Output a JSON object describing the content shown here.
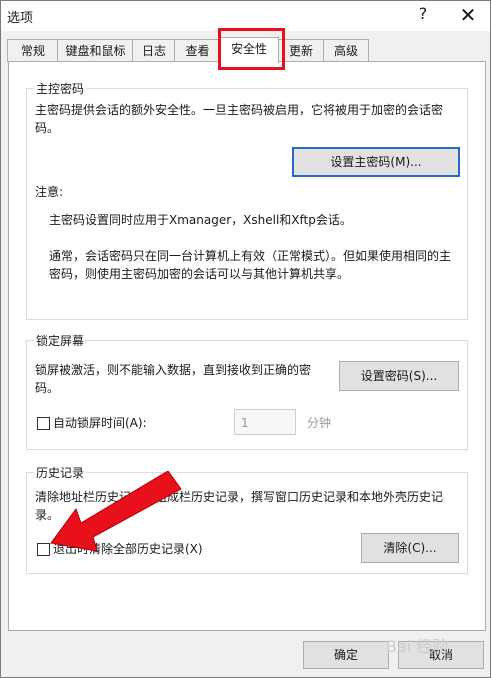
{
  "window": {
    "title": "选项",
    "help_glyph": "?",
    "close_glyph": "✕"
  },
  "tabs": [
    {
      "label": "常规"
    },
    {
      "label": "键盘和鼠标"
    },
    {
      "label": "日志"
    },
    {
      "label": "查看"
    },
    {
      "label": "安全性",
      "active": true
    },
    {
      "label": "更新"
    },
    {
      "label": "高级"
    }
  ],
  "master_password": {
    "legend": "主控密码",
    "description": "主密码提供会话的额外安全性。一旦主密码被启用，它将被用于加密的会话密码。",
    "set_button": "设置主密码(M)...",
    "note_title": "注意:",
    "note_1": "主密码设置同时应用于Xmanager，Xshell和Xftp会话。",
    "note_2": "通常，会话密码只在同一台计算机上有效（正常模式）。但如果使用相同的主密码，则使用主密码加密的会话可以与其他计算机共享。"
  },
  "lock_screen": {
    "legend": "锁定屏幕",
    "description": "锁屏被激活，则不能输入数据，直到接收到正确的密码。",
    "set_button": "设置密码(S)...",
    "auto_lock_label": "自动锁屏时间(A):",
    "auto_lock_value": "1",
    "unit": "分钟"
  },
  "history": {
    "legend": "历史记录",
    "description": "清除地址栏历史记录，组成栏历史记录，撰写窗口历史记录和本地外壳历史记录。",
    "clear_on_exit_label": "退出时清除全部历史记录(X)",
    "clear_button": "清除(C)..."
  },
  "footer": {
    "ok": "确定",
    "cancel": "取消"
  },
  "watermark": "Bai 经验",
  "colors": {
    "highlight_red": "#e8101a",
    "accent_blue": "#2a6ac7"
  }
}
